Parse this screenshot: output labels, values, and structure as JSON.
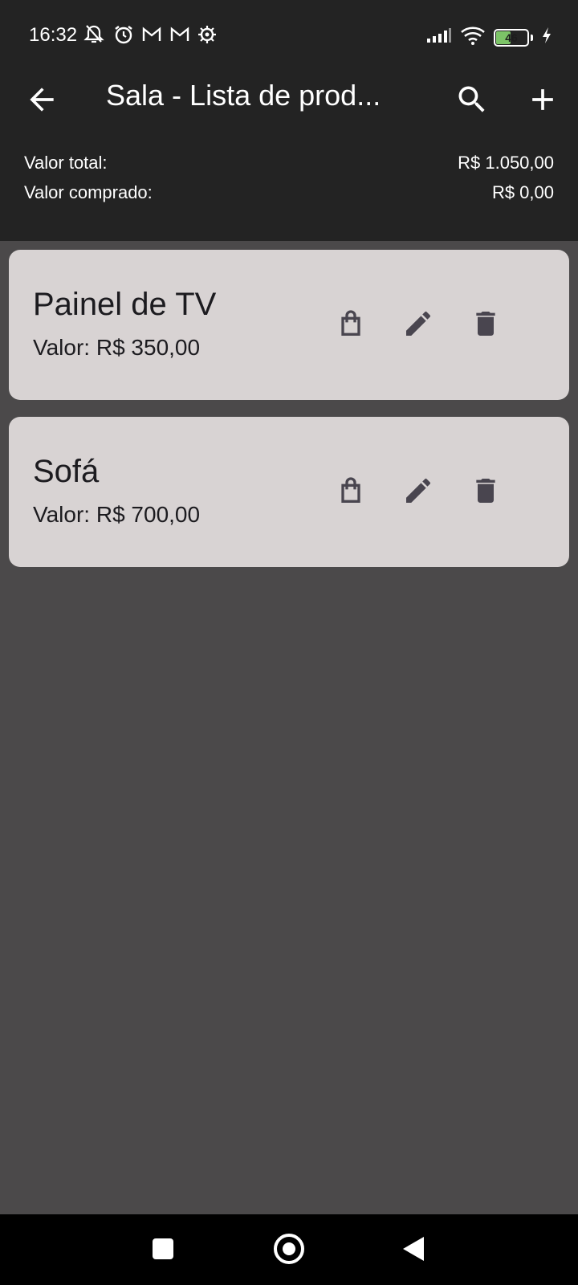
{
  "status_bar": {
    "time": "16:32",
    "battery_level": "46",
    "battery_fraction": 0.46,
    "left_icons": [
      "mute-notifications-icon",
      "alarm-icon",
      "gmail-icon",
      "gmail-icon",
      "settings-icon"
    ],
    "right_icons": [
      "signal-icon",
      "wifi-icon",
      "battery-icon",
      "charging-icon"
    ]
  },
  "app_bar": {
    "title": "Sala - Lista de prod...",
    "back_icon": "arrow-back-icon",
    "search_icon": "search-icon",
    "add_icon": "add-icon"
  },
  "summary": {
    "total_label": "Valor total:",
    "total_value": "R$ 1.050,00",
    "bought_label": "Valor comprado:",
    "bought_value": "R$ 0,00"
  },
  "products": [
    {
      "name": "Painel de TV",
      "price": "Valor: R$ 350,00"
    },
    {
      "name": "Sofá",
      "price": "Valor: R$ 700,00"
    }
  ],
  "colors": {
    "app_bar": "#232323",
    "background": "#4b494a",
    "card": "#d8d3d3",
    "icon": "#49454f",
    "battery": "#7cc467"
  }
}
